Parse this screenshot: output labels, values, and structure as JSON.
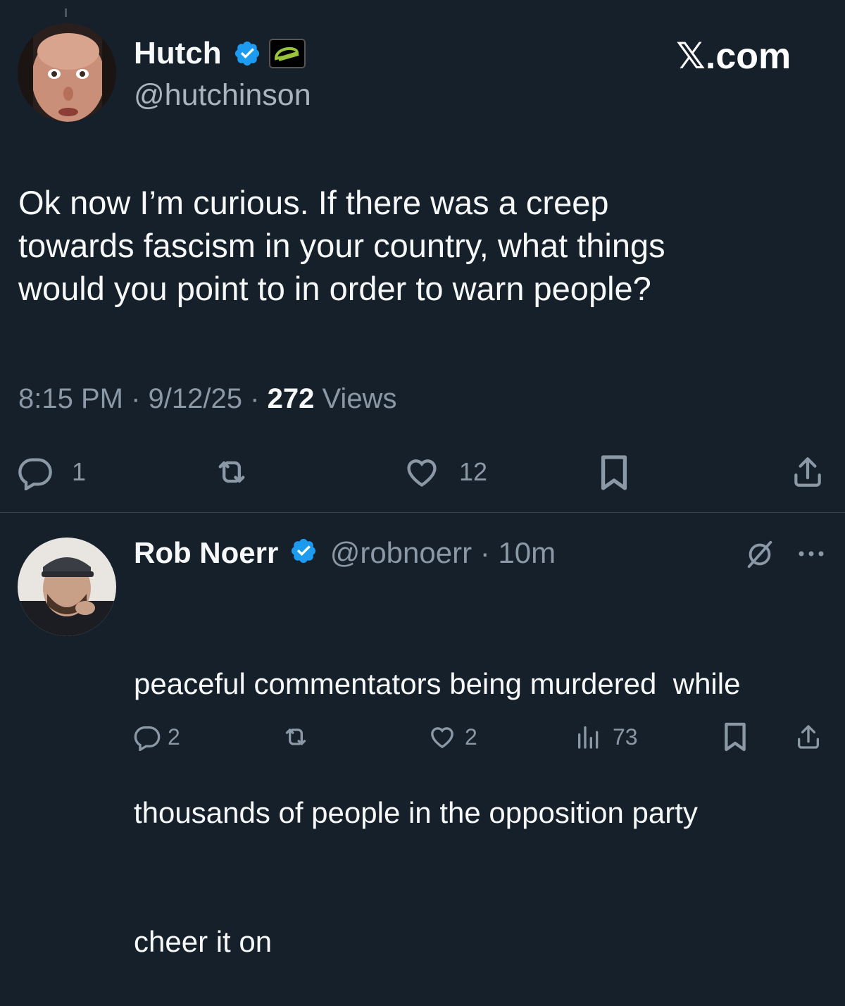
{
  "watermark": "𝕏.com",
  "main_tweet": {
    "display_name": "Hutch",
    "handle": "@hutchinson",
    "text_lines": [
      "Ok now I’m curious. If there was a creep",
      "towards fascism in your country, what things",
      "would you point to in order to warn people?"
    ],
    "time": "8:15 PM",
    "sep1": "·",
    "date": "9/12/25",
    "sep2": "·",
    "views_count": "272",
    "views_label": "Views",
    "replies": "1",
    "likes": "12",
    "icons": [
      "reply-icon",
      "retweet-icon",
      "like-icon",
      "bookmark-icon",
      "share-icon"
    ]
  },
  "reply_tweet": {
    "display_name": "Rob Noerr",
    "handle": "@robnoerr",
    "sep": "·",
    "time_ago": "10m",
    "text_lines": [
      "peaceful commentators being murdered  while",
      "thousands of people in the opposition party",
      "cheer it on"
    ],
    "replies": "2",
    "likes": "2",
    "views": "73",
    "icons": [
      "reply-icon",
      "retweet-icon",
      "like-icon",
      "analytics-icon",
      "bookmark-icon",
      "share-icon",
      "grok-icon",
      "more-icon"
    ]
  },
  "colors": {
    "background": "#15202b",
    "text": "#f7f9f9",
    "muted": "#8b98a5",
    "verified": "#1d9bf0",
    "divider": "#38444d",
    "badge_green": "#9ac33c"
  }
}
